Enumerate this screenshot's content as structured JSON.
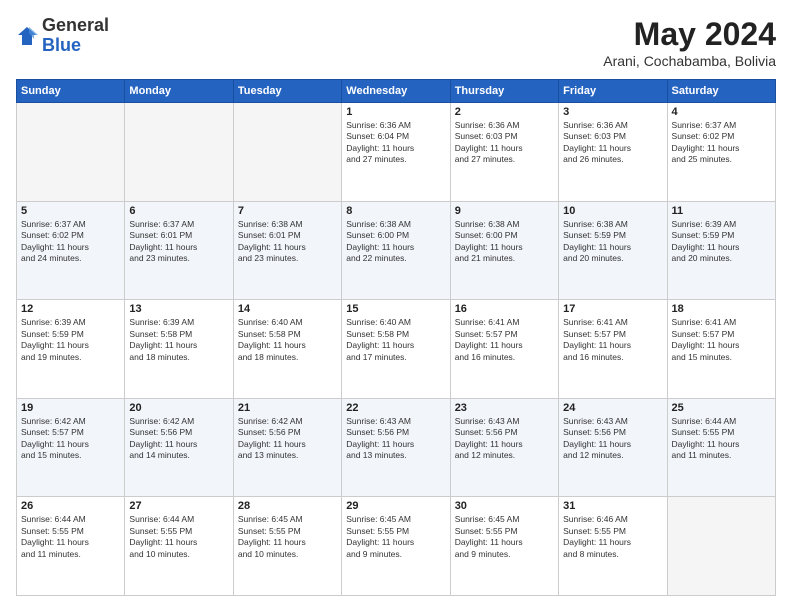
{
  "header": {
    "logo_general": "General",
    "logo_blue": "Blue",
    "month_title": "May 2024",
    "subtitle": "Arani, Cochabamba, Bolivia"
  },
  "days_of_week": [
    "Sunday",
    "Monday",
    "Tuesday",
    "Wednesday",
    "Thursday",
    "Friday",
    "Saturday"
  ],
  "weeks": [
    [
      {
        "day": "",
        "info": ""
      },
      {
        "day": "",
        "info": ""
      },
      {
        "day": "",
        "info": ""
      },
      {
        "day": "1",
        "info": "Sunrise: 6:36 AM\nSunset: 6:04 PM\nDaylight: 11 hours\nand 27 minutes."
      },
      {
        "day": "2",
        "info": "Sunrise: 6:36 AM\nSunset: 6:03 PM\nDaylight: 11 hours\nand 27 minutes."
      },
      {
        "day": "3",
        "info": "Sunrise: 6:36 AM\nSunset: 6:03 PM\nDaylight: 11 hours\nand 26 minutes."
      },
      {
        "day": "4",
        "info": "Sunrise: 6:37 AM\nSunset: 6:02 PM\nDaylight: 11 hours\nand 25 minutes."
      }
    ],
    [
      {
        "day": "5",
        "info": "Sunrise: 6:37 AM\nSunset: 6:02 PM\nDaylight: 11 hours\nand 24 minutes."
      },
      {
        "day": "6",
        "info": "Sunrise: 6:37 AM\nSunset: 6:01 PM\nDaylight: 11 hours\nand 23 minutes."
      },
      {
        "day": "7",
        "info": "Sunrise: 6:38 AM\nSunset: 6:01 PM\nDaylight: 11 hours\nand 23 minutes."
      },
      {
        "day": "8",
        "info": "Sunrise: 6:38 AM\nSunset: 6:00 PM\nDaylight: 11 hours\nand 22 minutes."
      },
      {
        "day": "9",
        "info": "Sunrise: 6:38 AM\nSunset: 6:00 PM\nDaylight: 11 hours\nand 21 minutes."
      },
      {
        "day": "10",
        "info": "Sunrise: 6:38 AM\nSunset: 5:59 PM\nDaylight: 11 hours\nand 20 minutes."
      },
      {
        "day": "11",
        "info": "Sunrise: 6:39 AM\nSunset: 5:59 PM\nDaylight: 11 hours\nand 20 minutes."
      }
    ],
    [
      {
        "day": "12",
        "info": "Sunrise: 6:39 AM\nSunset: 5:59 PM\nDaylight: 11 hours\nand 19 minutes."
      },
      {
        "day": "13",
        "info": "Sunrise: 6:39 AM\nSunset: 5:58 PM\nDaylight: 11 hours\nand 18 minutes."
      },
      {
        "day": "14",
        "info": "Sunrise: 6:40 AM\nSunset: 5:58 PM\nDaylight: 11 hours\nand 18 minutes."
      },
      {
        "day": "15",
        "info": "Sunrise: 6:40 AM\nSunset: 5:58 PM\nDaylight: 11 hours\nand 17 minutes."
      },
      {
        "day": "16",
        "info": "Sunrise: 6:41 AM\nSunset: 5:57 PM\nDaylight: 11 hours\nand 16 minutes."
      },
      {
        "day": "17",
        "info": "Sunrise: 6:41 AM\nSunset: 5:57 PM\nDaylight: 11 hours\nand 16 minutes."
      },
      {
        "day": "18",
        "info": "Sunrise: 6:41 AM\nSunset: 5:57 PM\nDaylight: 11 hours\nand 15 minutes."
      }
    ],
    [
      {
        "day": "19",
        "info": "Sunrise: 6:42 AM\nSunset: 5:57 PM\nDaylight: 11 hours\nand 15 minutes."
      },
      {
        "day": "20",
        "info": "Sunrise: 6:42 AM\nSunset: 5:56 PM\nDaylight: 11 hours\nand 14 minutes."
      },
      {
        "day": "21",
        "info": "Sunrise: 6:42 AM\nSunset: 5:56 PM\nDaylight: 11 hours\nand 13 minutes."
      },
      {
        "day": "22",
        "info": "Sunrise: 6:43 AM\nSunset: 5:56 PM\nDaylight: 11 hours\nand 13 minutes."
      },
      {
        "day": "23",
        "info": "Sunrise: 6:43 AM\nSunset: 5:56 PM\nDaylight: 11 hours\nand 12 minutes."
      },
      {
        "day": "24",
        "info": "Sunrise: 6:43 AM\nSunset: 5:56 PM\nDaylight: 11 hours\nand 12 minutes."
      },
      {
        "day": "25",
        "info": "Sunrise: 6:44 AM\nSunset: 5:55 PM\nDaylight: 11 hours\nand 11 minutes."
      }
    ],
    [
      {
        "day": "26",
        "info": "Sunrise: 6:44 AM\nSunset: 5:55 PM\nDaylight: 11 hours\nand 11 minutes."
      },
      {
        "day": "27",
        "info": "Sunrise: 6:44 AM\nSunset: 5:55 PM\nDaylight: 11 hours\nand 10 minutes."
      },
      {
        "day": "28",
        "info": "Sunrise: 6:45 AM\nSunset: 5:55 PM\nDaylight: 11 hours\nand 10 minutes."
      },
      {
        "day": "29",
        "info": "Sunrise: 6:45 AM\nSunset: 5:55 PM\nDaylight: 11 hours\nand 9 minutes."
      },
      {
        "day": "30",
        "info": "Sunrise: 6:45 AM\nSunset: 5:55 PM\nDaylight: 11 hours\nand 9 minutes."
      },
      {
        "day": "31",
        "info": "Sunrise: 6:46 AM\nSunset: 5:55 PM\nDaylight: 11 hours\nand 8 minutes."
      },
      {
        "day": "",
        "info": ""
      }
    ]
  ]
}
